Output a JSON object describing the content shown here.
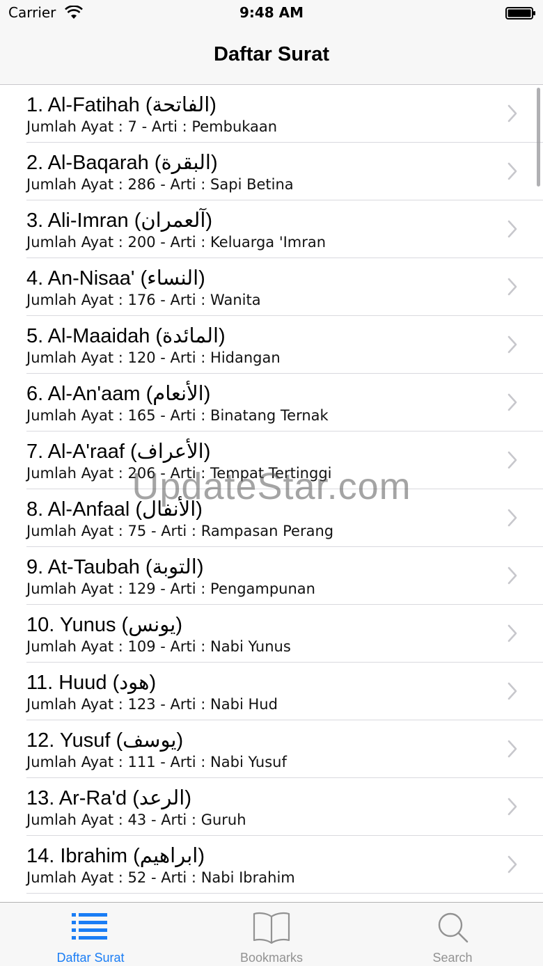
{
  "status_bar": {
    "carrier": "Carrier",
    "time": "9:48 AM"
  },
  "nav": {
    "title": "Daftar Surat"
  },
  "surahs": [
    {
      "title": "1. Al-Fatihah (الفاتحة)",
      "subtitle": "Jumlah Ayat : 7 -  Arti : Pembukaan"
    },
    {
      "title": "2. Al-Baqarah (البقرة)",
      "subtitle": "Jumlah Ayat : 286 -  Arti : Sapi Betina"
    },
    {
      "title": "3. Ali-Imran (آلعمران)",
      "subtitle": "Jumlah Ayat : 200 -  Arti : Keluarga 'Imran"
    },
    {
      "title": "4. An-Nisaa' (النساء)",
      "subtitle": "Jumlah Ayat : 176 -  Arti : Wanita"
    },
    {
      "title": "5. Al-Maaidah (المائدة)",
      "subtitle": "Jumlah Ayat : 120 -  Arti : Hidangan"
    },
    {
      "title": "6. Al-An'aam (الأنعام)",
      "subtitle": "Jumlah Ayat : 165 -  Arti : Binatang Ternak"
    },
    {
      "title": "7. Al-A'raaf (الأعراف)",
      "subtitle": "Jumlah Ayat : 206 -  Arti : Tempat Tertinggi"
    },
    {
      "title": "8. Al-Anfaal (الأنفال)",
      "subtitle": "Jumlah Ayat : 75 -  Arti : Rampasan Perang"
    },
    {
      "title": "9. At-Taubah (التوبة)",
      "subtitle": "Jumlah Ayat : 129 -  Arti : Pengampunan"
    },
    {
      "title": "10. Yunus (يونس)",
      "subtitle": "Jumlah Ayat : 109 -  Arti : Nabi Yunus"
    },
    {
      "title": "11. Huud (هود)",
      "subtitle": "Jumlah Ayat : 123 -  Arti : Nabi Hud"
    },
    {
      "title": "12. Yusuf (يوسف)",
      "subtitle": "Jumlah Ayat : 111 -  Arti : Nabi Yusuf"
    },
    {
      "title": "13. Ar-Ra'd (الرعد)",
      "subtitle": "Jumlah Ayat : 43 -  Arti : Guruh"
    },
    {
      "title": "14. Ibrahim (ابراهيم)",
      "subtitle": "Jumlah Ayat : 52 -  Arti : Nabi Ibrahim"
    }
  ],
  "watermark": "UpdateStar.com",
  "tabbar": {
    "tabs": [
      {
        "label": "Daftar Surat",
        "icon": "list-icon",
        "selected": true
      },
      {
        "label": "Bookmarks",
        "icon": "book-icon",
        "selected": false
      },
      {
        "label": "Search",
        "icon": "search-icon",
        "selected": false
      }
    ]
  },
  "colors": {
    "accent": "#1a7df5",
    "inactive": "#929292",
    "bar_background": "#f7f7f7"
  }
}
